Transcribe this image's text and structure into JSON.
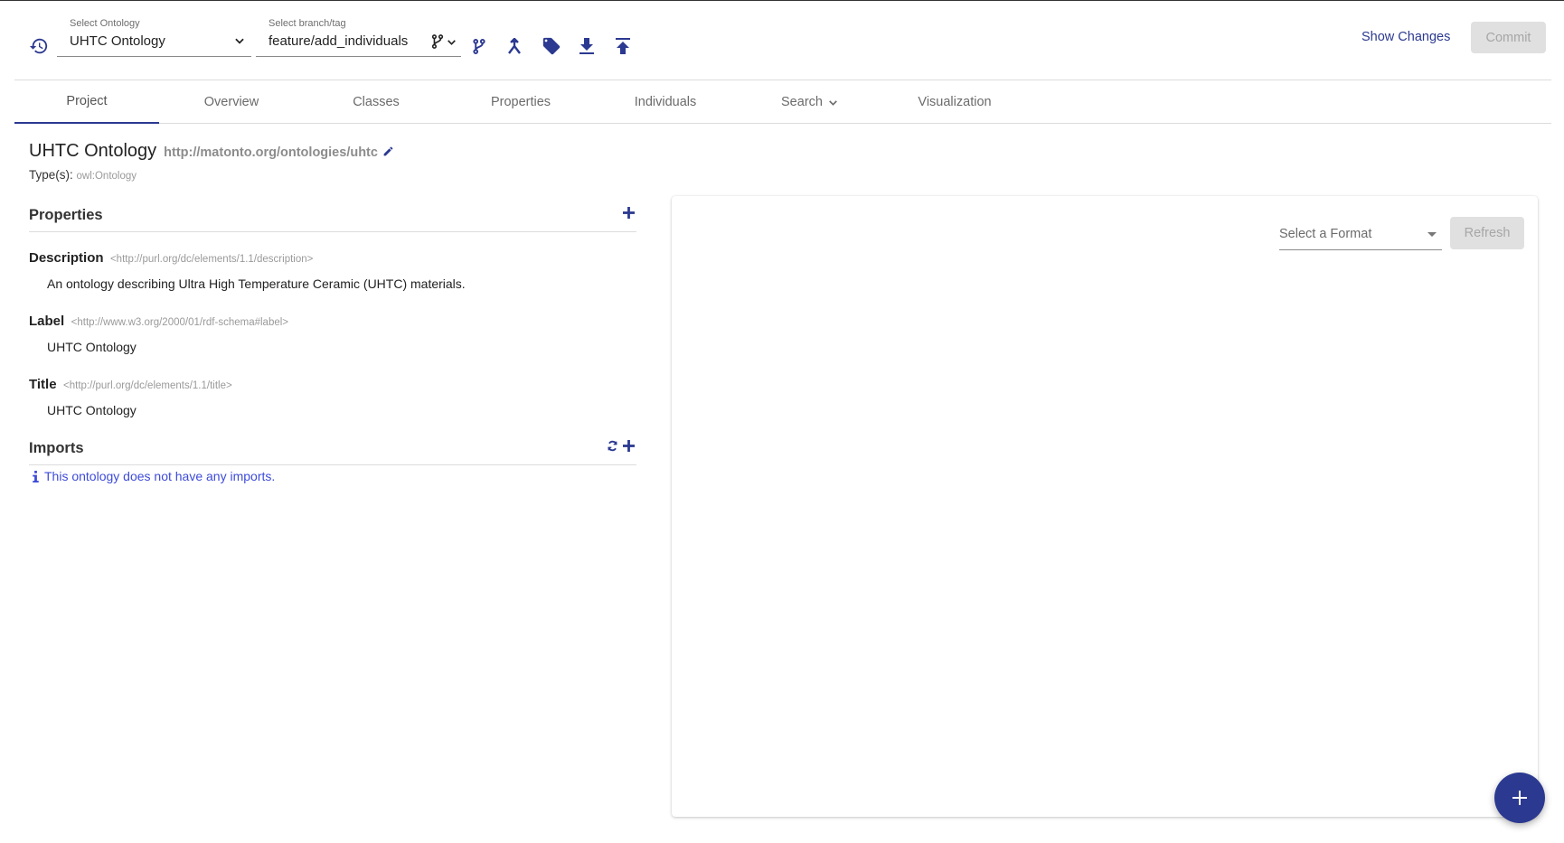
{
  "header": {
    "ontology_select": {
      "label": "Select Ontology",
      "value": "UHTC Ontology"
    },
    "branch_select": {
      "label": "Select branch/tag",
      "value": "feature/add_individuals"
    },
    "show_changes_label": "Show Changes",
    "commit_label": "Commit",
    "icons": [
      "history-icon",
      "branch-menu-icon",
      "create-branch-icon",
      "merge-icon",
      "tag-icon",
      "download-icon",
      "upload-icon"
    ]
  },
  "tabs": [
    {
      "label": "Project",
      "active": true
    },
    {
      "label": "Overview",
      "active": false
    },
    {
      "label": "Classes",
      "active": false
    },
    {
      "label": "Properties",
      "active": false
    },
    {
      "label": "Individuals",
      "active": false
    },
    {
      "label": "Search",
      "active": false,
      "has_dropdown": true
    },
    {
      "label": "Visualization",
      "active": false
    }
  ],
  "ontology": {
    "name": "UHTC Ontology",
    "iri": "http://matonto.org/ontologies/uhtc",
    "types_label": "Type(s):",
    "types_value": "owl:Ontology"
  },
  "properties_section": {
    "title": "Properties",
    "items": [
      {
        "name": "Description",
        "iri": "<http://purl.org/dc/elements/1.1/description>",
        "value": "An ontology describing Ultra High Temperature Ceramic (UHTC) materials."
      },
      {
        "name": "Label",
        "iri": "<http://www.w3.org/2000/01/rdf-schema#label>",
        "value": "UHTC Ontology"
      },
      {
        "name": "Title",
        "iri": "<http://purl.org/dc/elements/1.1/title>",
        "value": "UHTC Ontology"
      }
    ]
  },
  "imports_section": {
    "title": "Imports",
    "empty_message": "This ontology does not have any imports."
  },
  "preview_panel": {
    "format_placeholder": "Select a Format",
    "refresh_label": "Refresh"
  },
  "colors": {
    "primary": "#2b3990",
    "info": "#3d4bd9",
    "disabled_bg": "#e0e0e0",
    "disabled_text": "#a6a6a6"
  }
}
